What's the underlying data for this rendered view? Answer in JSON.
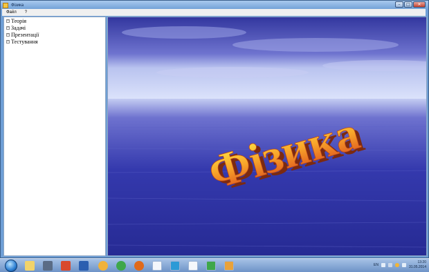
{
  "window": {
    "title": "Фізика",
    "buttons": {
      "minimize": "–",
      "maximize": "□",
      "close": "✕"
    }
  },
  "menu": {
    "items": [
      "Файл",
      "?"
    ]
  },
  "sidebar": {
    "items": [
      {
        "expander": "+",
        "label": "Теорія"
      },
      {
        "expander": "+",
        "label": "Задачі"
      },
      {
        "expander": "+",
        "label": "Презентації"
      },
      {
        "expander": "+",
        "label": "Тестування"
      }
    ]
  },
  "content": {
    "headline": "Фізика",
    "background": "sky-over-sea"
  },
  "taskbar": {
    "icons": [
      "start-orb-icon",
      "file-explorer-icon",
      "tool-icon",
      "paint-icon",
      "visual-studio-icon",
      "media-player-icon",
      "chrome-icon",
      "firefox-icon",
      "floppy-save-icon",
      "skype-icon",
      "notepad-icon",
      "chrome-icon",
      "app-window-icon"
    ],
    "tray": {
      "language": "EN",
      "time": "13:20",
      "date": "31.05.2014"
    }
  },
  "colors": {
    "title_bar": "#6f9fd6",
    "sky": "#3a3fb0",
    "sea": "#2b2d9c",
    "headline_top": "#ffe23a",
    "headline_bottom": "#e4551a"
  }
}
